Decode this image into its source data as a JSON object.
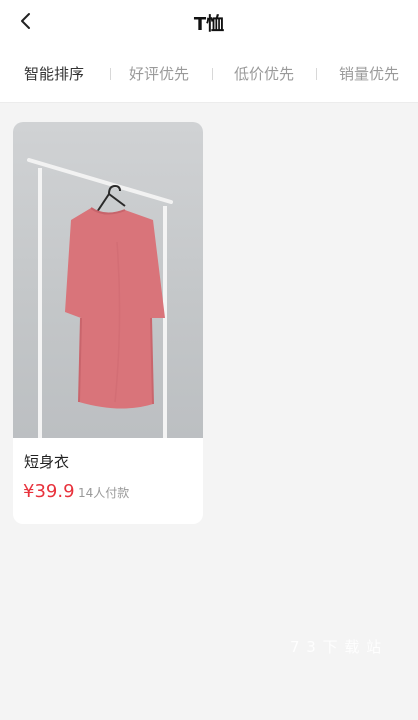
{
  "header": {
    "title": "T恤"
  },
  "sort_tabs": [
    {
      "label": "智能排序",
      "active": true
    },
    {
      "label": "好评优先",
      "active": false
    },
    {
      "label": "低价优先",
      "active": false
    },
    {
      "label": "销量优先",
      "active": false
    }
  ],
  "products": [
    {
      "name": "短身衣",
      "price": "¥39.9",
      "buyers": "14人付款",
      "image_icon": "pink-tshirt-on-hanger-image"
    }
  ],
  "watermark": "7 3 下 载 站",
  "colors": {
    "price": "#e8323c",
    "shirt": "#d9747a",
    "background": "#f4f4f4"
  }
}
